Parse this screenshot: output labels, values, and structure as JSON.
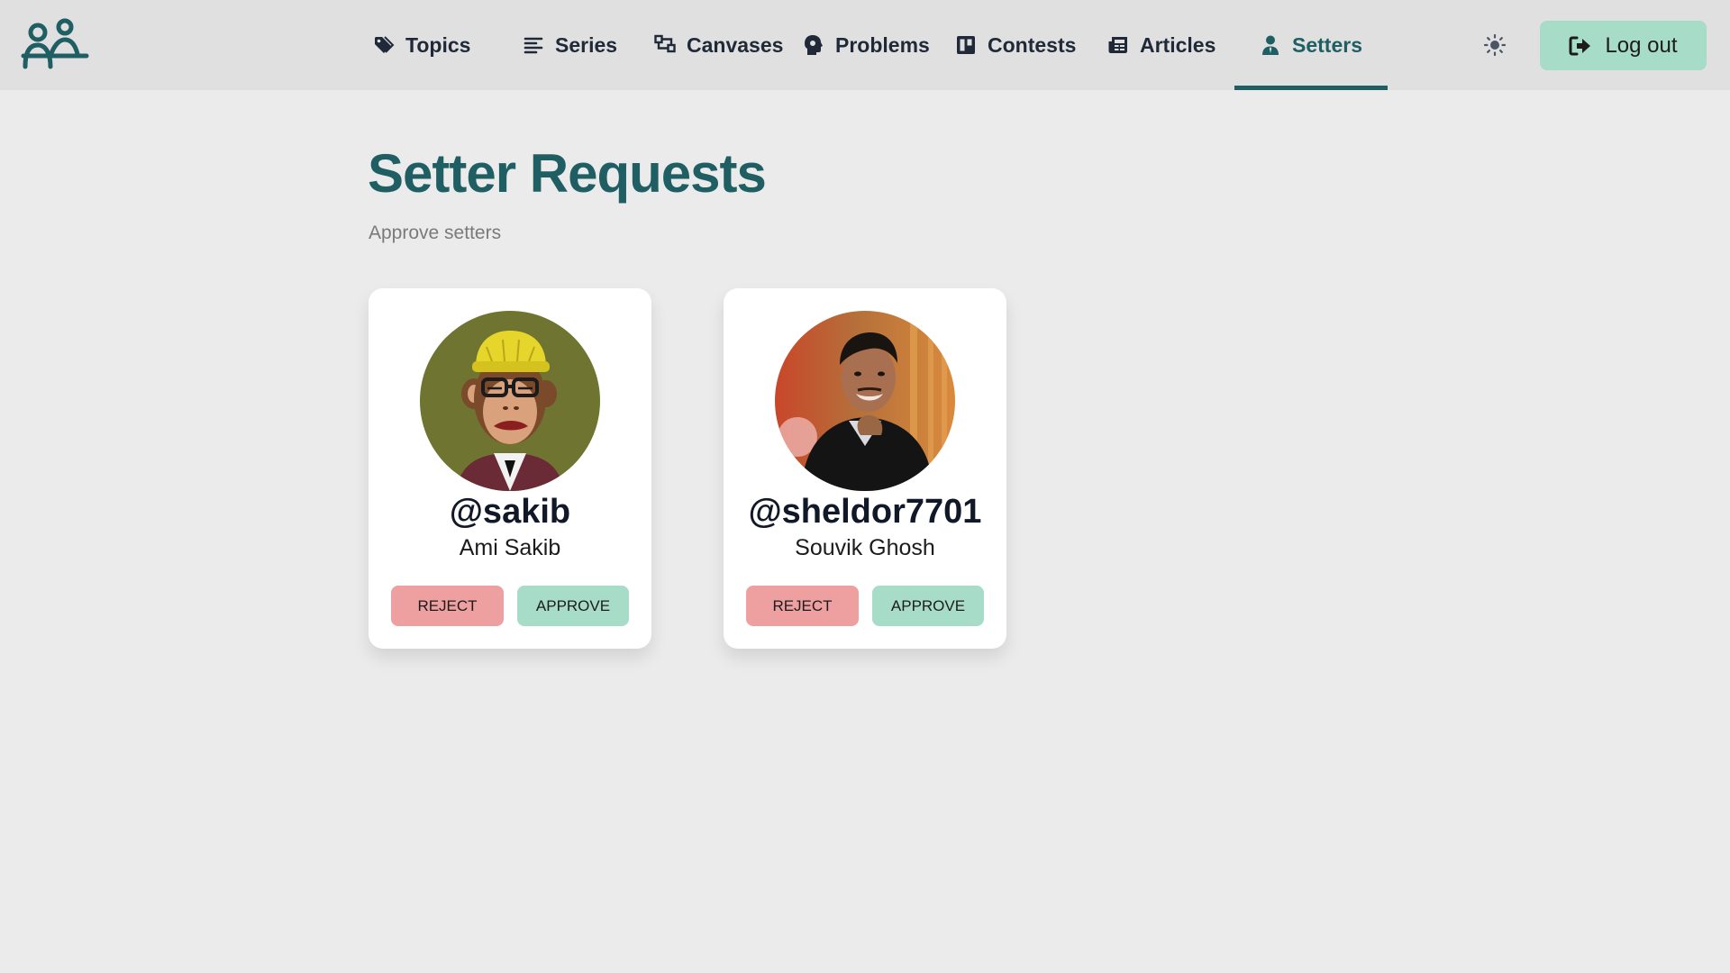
{
  "navbar": {
    "logo_icon": "people-logo-icon",
    "items": [
      {
        "label": "Topics",
        "icon": "tag-icon"
      },
      {
        "label": "Series",
        "icon": "list-icon"
      },
      {
        "label": "Canvases",
        "icon": "canvas-icon"
      },
      {
        "label": "Problems",
        "icon": "brain-icon"
      },
      {
        "label": "Contests",
        "icon": "board-icon"
      },
      {
        "label": "Articles",
        "icon": "newspaper-icon"
      },
      {
        "label": "Setters",
        "icon": "user-tie-icon",
        "active": true
      }
    ],
    "theme_toggle_icon": "sun-icon",
    "logout_label": "Log out",
    "logout_icon": "logout-icon"
  },
  "page": {
    "title": "Setter Requests",
    "subtitle": "Approve setters"
  },
  "requests": [
    {
      "handle": "@sakib",
      "name": "Ami Sakib",
      "reject_label": "REJECT",
      "approve_label": "APPROVE",
      "avatar": "ape-avatar"
    },
    {
      "handle": "@sheldor7701",
      "name": "Souvik Ghosh",
      "reject_label": "REJECT",
      "approve_label": "APPROVE",
      "avatar": "photo-avatar"
    }
  ],
  "colors": {
    "accent": "#1f5f63",
    "approve": "#a7dcc9",
    "reject": "#ee9fa0",
    "background": "#ebebeb",
    "navbar": "#e0e0e0"
  }
}
